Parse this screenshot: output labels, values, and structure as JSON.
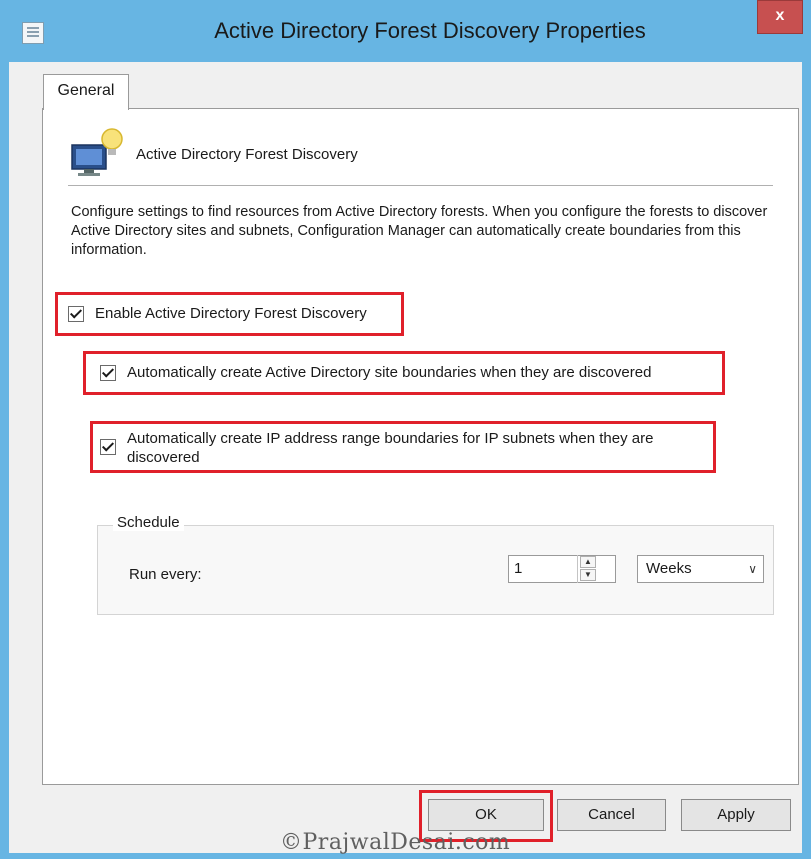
{
  "window": {
    "title": "Active Directory Forest Discovery Properties",
    "close_label": "x"
  },
  "tabs": [
    {
      "label": "General"
    }
  ],
  "feature": {
    "name": "Active Directory Forest Discovery"
  },
  "description": "Configure settings to find resources from Active Directory forests. When you configure the forests to discover Active Directory sites and subnets, Configuration Manager can automatically create boundaries from this information.",
  "options": {
    "enable": {
      "label": "Enable Active Directory Forest Discovery",
      "checked": true
    },
    "site_boundaries": {
      "label": "Automatically create Active Directory site boundaries when they are discovered",
      "checked": true
    },
    "ip_boundaries": {
      "label": "Automatically create IP address range boundaries for IP subnets when they are discovered",
      "checked": true
    }
  },
  "schedule": {
    "title": "Schedule",
    "run_every_label": "Run every:",
    "interval_value": "1",
    "unit_value": "Weeks"
  },
  "buttons": {
    "ok": "OK",
    "cancel": "Cancel",
    "apply": "Apply"
  },
  "watermark": "©PrajwalDesai.com",
  "colors": {
    "highlight": "#e0202a",
    "titlebar": "#67b5e3",
    "close": "#c75050"
  }
}
